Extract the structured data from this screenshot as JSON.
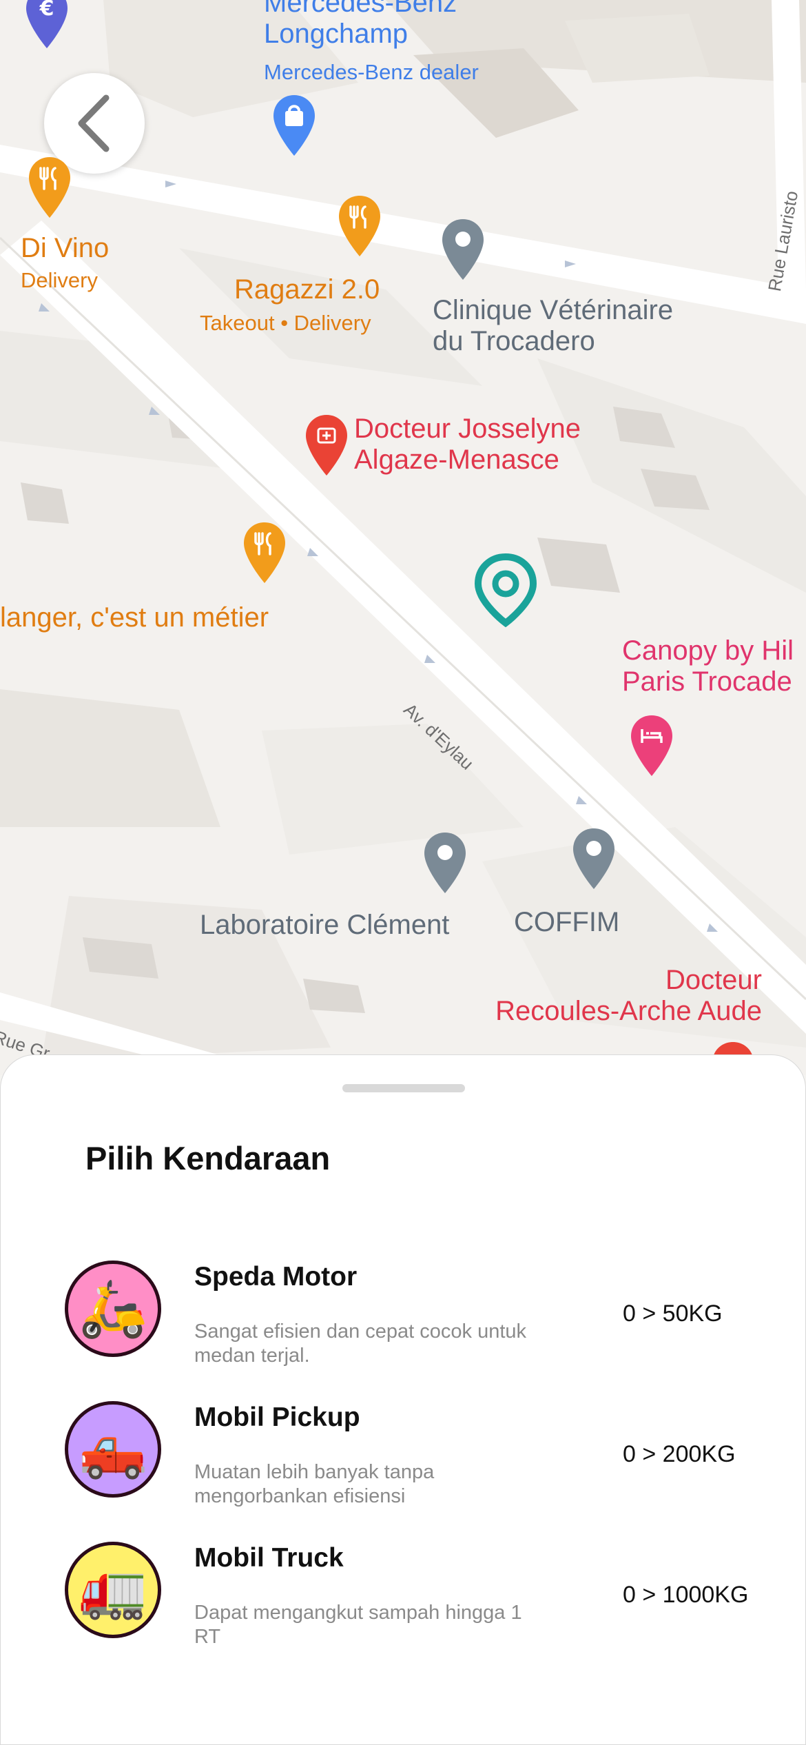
{
  "map": {
    "places": {
      "mercedes_name": "Mercedes-Benz Longchamp",
      "mercedes_name_line1": "Mercedes-Benz",
      "mercedes_name_line2": "Longchamp",
      "mercedes_type": "Mercedes-Benz dealer",
      "divino_name": "Di Vino",
      "divino_sub": "Delivery",
      "ragazzi_name": "Ragazzi 2.0",
      "ragazzi_sub": "Takeout • Delivery",
      "clinique_line1": "Clinique Vétérinaire",
      "clinique_line2": "du Trocadero",
      "docteur_j_line1": "Docteur Josselyne",
      "docteur_j_line2": "Algaze-Menasce",
      "boulanger": "langer, c'est un métier",
      "canopy_line1": "Canopy by Hil",
      "canopy_line2": "Paris Trocade",
      "laboratoire": "Laboratoire Clément",
      "coffim": "COFFIM",
      "docteur_r_line1": "Docteur",
      "docteur_r_line2": "Recoules-Arche Aude"
    },
    "streets": {
      "eylau": "Av. d'Eylau",
      "lauriston": "Rue Lauristo",
      "rue_gr": "Rue Gr"
    },
    "icons": {
      "back": "chevron-left-icon",
      "location": "location-pin-icon"
    },
    "colors": {
      "location_pin": "#1aa39a",
      "restaurant_pin": "#f29c1b",
      "shop_pin": "#4a8af4",
      "poi_pin": "#7b8a96",
      "medical_pin": "#ea4335",
      "hotel_pin": "#ec407a"
    }
  },
  "sheet": {
    "title": "Pilih Kendaraan",
    "vehicles": [
      {
        "name": "Speda Motor",
        "description": "Sangat efisien dan cepat cocok untuk medan terjal.",
        "capacity": "0 > 50KG",
        "icon": "🛵",
        "bg_color": "#ff8ec6"
      },
      {
        "name": "Mobil Pickup",
        "description": "Muatan lebih banyak tanpa mengorbankan efisiensi",
        "capacity": "0 > 200KG",
        "icon": "🛻",
        "bg_color": "#c79cff"
      },
      {
        "name": "Mobil Truck",
        "description": "Dapat mengangkut sampah hingga 1 RT",
        "capacity": "0 > 1000KG",
        "icon": "🚛",
        "bg_color": "#fff06b"
      }
    ]
  }
}
